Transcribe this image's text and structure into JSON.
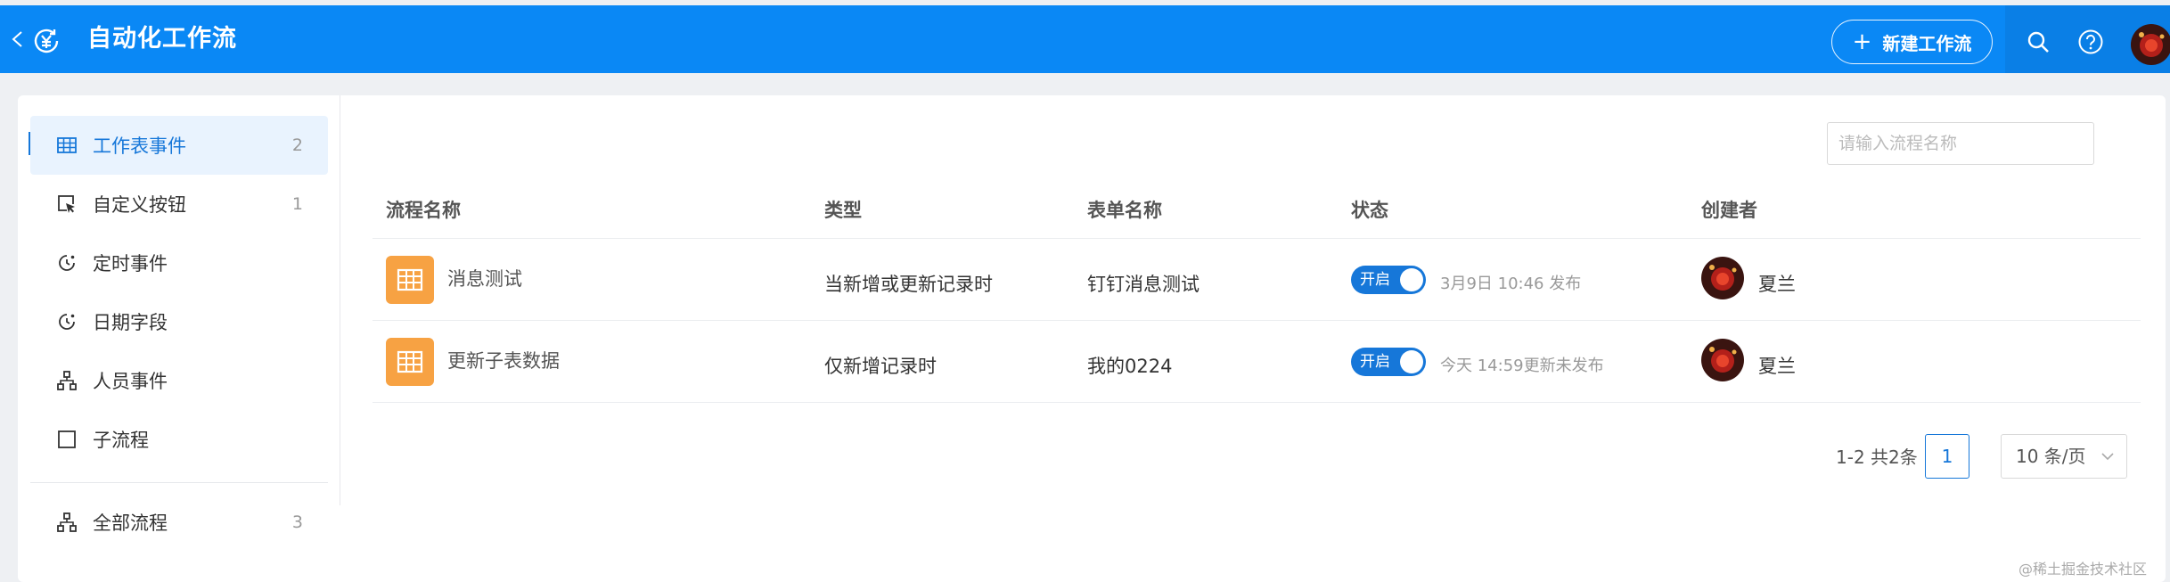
{
  "header": {
    "title": "自动化工作流",
    "new_button_label": "新建工作流",
    "icons": [
      "back-icon",
      "workflow-app-icon",
      "plus-icon",
      "search-icon",
      "help-icon",
      "user-avatar"
    ]
  },
  "sidebar": {
    "items": [
      {
        "label": "工作表事件",
        "count": "2",
        "icon": "table-icon",
        "active": true
      },
      {
        "label": "自定义按钮",
        "count": "1",
        "icon": "cursor-click-icon"
      },
      {
        "label": "定时事件",
        "count": "",
        "icon": "clock-icon"
      },
      {
        "label": "日期字段",
        "count": "",
        "icon": "clock-icon"
      },
      {
        "label": "人员事件",
        "count": "",
        "icon": "org-chart-icon"
      },
      {
        "label": "子流程",
        "count": "",
        "icon": "square-icon"
      },
      {
        "label": "全部流程",
        "count": "3",
        "icon": "org-chart-icon"
      }
    ]
  },
  "search": {
    "placeholder": "请输入流程名称"
  },
  "table": {
    "columns": [
      "流程名称",
      "类型",
      "表单名称",
      "状态",
      "创建者"
    ],
    "rows": [
      {
        "name": "消息测试",
        "type": "当新增或更新记录时",
        "form": "钉钉消息测试",
        "toggle": "开启",
        "status_note": "3月9日 10:46 发布",
        "creator": "夏兰"
      },
      {
        "name": "更新子表数据",
        "type": "仅新增记录时",
        "form": "我的0224",
        "toggle": "开启",
        "status_note": "今天 14:59更新未发布",
        "creator": "夏兰"
      }
    ]
  },
  "pagination": {
    "total": "1-2 共2条",
    "current_page": "1",
    "page_size": "10 条/页"
  },
  "watermark": "@稀土掘金技术社区",
  "colors": {
    "header_bg": "#0a88f5",
    "accent": "#1677d9",
    "workflow_icon_bg": "#f7a243"
  }
}
